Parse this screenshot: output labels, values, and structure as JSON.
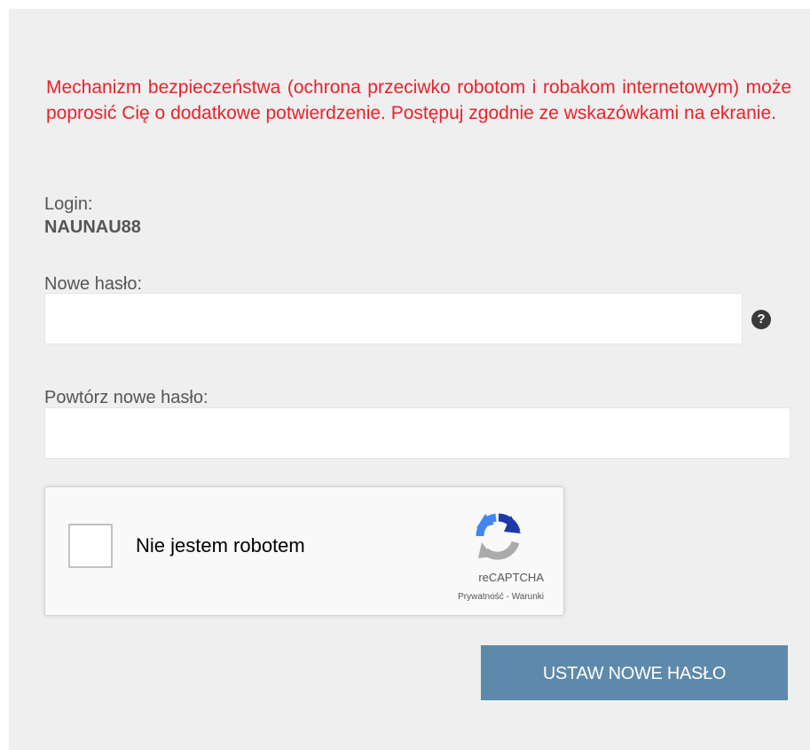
{
  "warning_text": "Mechanizm bezpieczeństwa (ochrona przeciwko robotom i robakom internetowym) może poprosić Cię o dodatkowe potwierdzenie. Postępuj zgodnie ze wskazówkami na ekranie.",
  "login": {
    "label": "Login:",
    "value": "NAUNAU88"
  },
  "new_password": {
    "label": "Nowe hasło:",
    "value": "",
    "help_icon": "question-circle-icon"
  },
  "repeat_password": {
    "label": "Powtórz nowe hasło:",
    "value": ""
  },
  "recaptcha": {
    "checkbox_label": "Nie jestem robotem",
    "brand": "reCAPTCHA",
    "links": "Prywatność - Warunki",
    "logo_icon": "recaptcha-logo-icon"
  },
  "submit_label": "USTAW NOWE HASŁO",
  "colors": {
    "warning": "#e8232b",
    "panel_background": "#efefef",
    "button_background": "#5d8aaa",
    "label_text": "#555555"
  }
}
